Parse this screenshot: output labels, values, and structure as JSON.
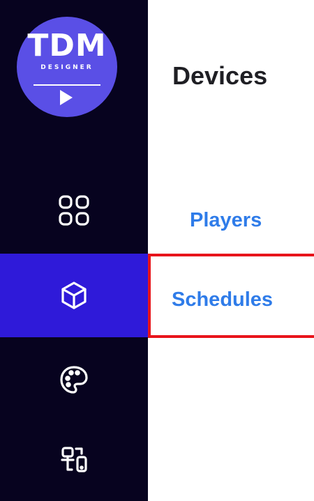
{
  "logo": {
    "title": "TDM",
    "subtitle": "DESIGNER"
  },
  "sidebar": {
    "items": [
      {
        "name": "dashboard",
        "icon": "grid-icon",
        "active": false
      },
      {
        "name": "devices",
        "icon": "cube-icon",
        "active": true
      },
      {
        "name": "designs",
        "icon": "palette-icon",
        "active": false
      },
      {
        "name": "connections",
        "icon": "device-link-icon",
        "active": false
      }
    ]
  },
  "panel": {
    "title": "Devices",
    "links": [
      {
        "label": "Players"
      },
      {
        "label": "Schedules"
      }
    ]
  },
  "colors": {
    "sidebar_bg": "#07031f",
    "active_bg": "#2f1ad9",
    "logo_bg": "#5a4fe6",
    "link": "#2f7ce9",
    "highlight": "#e8141b"
  }
}
